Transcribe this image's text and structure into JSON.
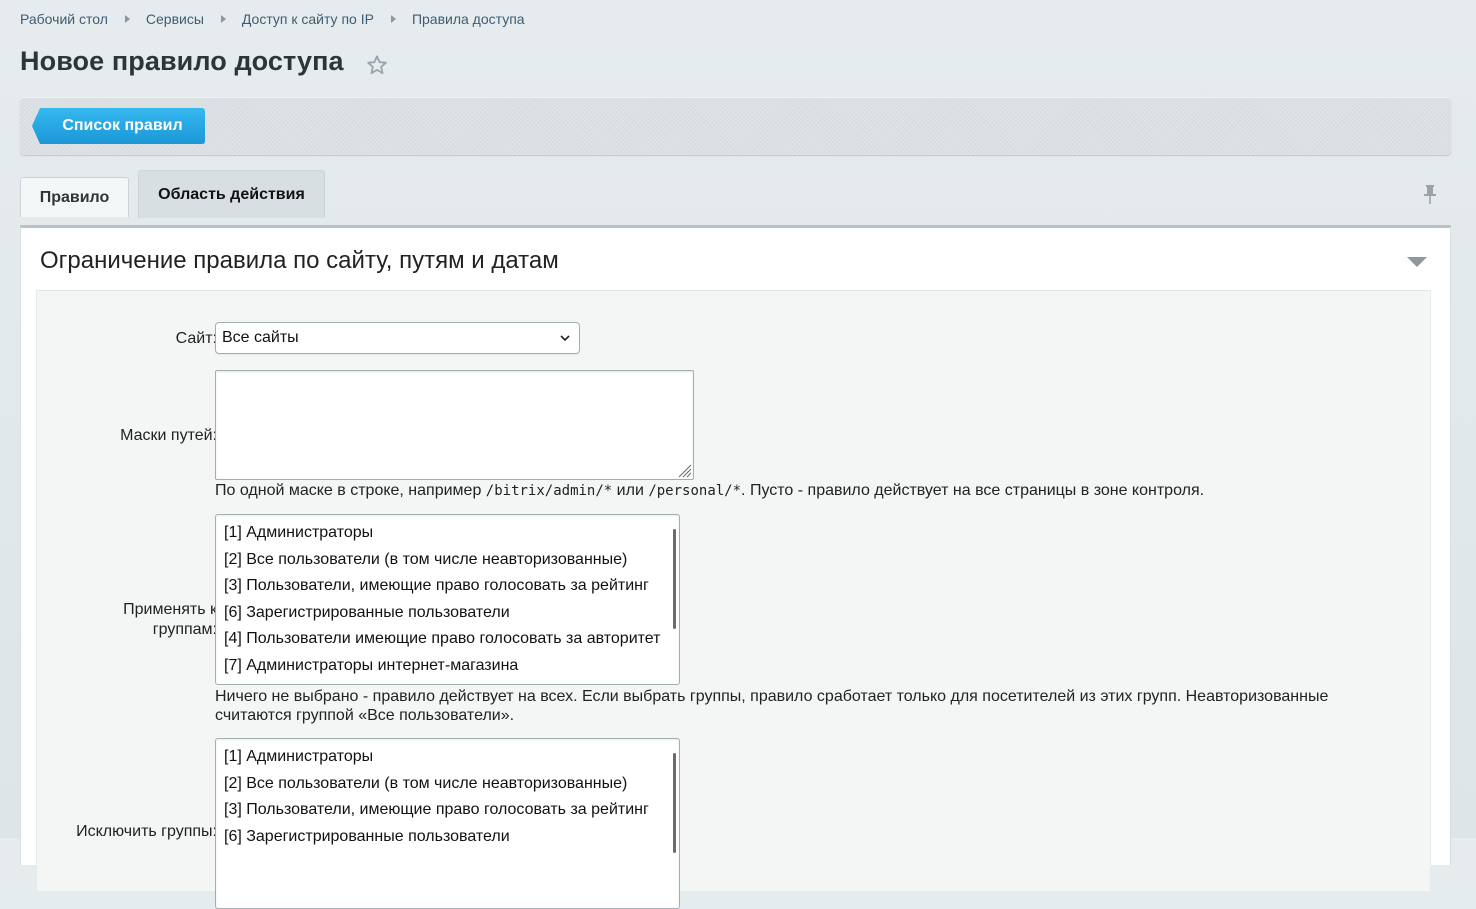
{
  "breadcrumb": [
    "Рабочий стол",
    "Сервисы",
    "Доступ к сайту по IP",
    "Правила доступа"
  ],
  "page_title": "Новое правило доступа",
  "toolbar": {
    "back_label": "Список правил"
  },
  "tabs": [
    {
      "label": "Правило"
    },
    {
      "label": "Область действия",
      "active": true
    }
  ],
  "section": {
    "title": "Ограничение правила по сайту, путям и датам",
    "site_label": "Сайт:",
    "site_value": "Все сайты",
    "paths_label": "Маски путей:",
    "paths_value": "",
    "paths_hint_1": "По одной маске в строке, например ",
    "paths_hint_code_1": "/bitrix/admin/*",
    "paths_hint_2": " или ",
    "paths_hint_code_2": "/personal/*",
    "paths_hint_3": ". Пусто - правило действует на все страницы в зоне контроля.",
    "apply_groups_label_1": "Применять к",
    "apply_groups_label_2": "группам:",
    "groups": [
      "[1] Администраторы",
      "[2] Все пользователи (в том числе неавторизованные)",
      "[3] Пользователи, имеющие право голосовать за рейтинг",
      "[6] Зарегистрированные пользователи",
      "[4] Пользователи имеющие право голосовать за авторитет",
      "[7] Администраторы интернет-магазина"
    ],
    "apply_groups_hint_1": "Ничего не выбрано - правило действует на всех. Если выбрать группы, правило сработает только для посетителей из этих групп. Неавторизованные",
    "apply_groups_hint_2": "считаются группой «Все пользователи».",
    "exclude_groups_label": "Исключить группы:",
    "exclude_groups": [
      "[1] Администраторы",
      "[2] Все пользователи (в том числе неавторизованные)",
      "[3] Пользователи, имеющие право голосовать за рейтинг",
      "[6] Зарегистрированные пользователи"
    ]
  },
  "colors": {
    "accent": "#1b97d6",
    "link": "#3d5c76",
    "title": "#2c3538"
  },
  "icons": {
    "favorite": "star-icon",
    "pin": "pin-icon",
    "collapse": "chevron-down-icon",
    "select": "chevron-down-icon",
    "resize": "resize-icon"
  }
}
